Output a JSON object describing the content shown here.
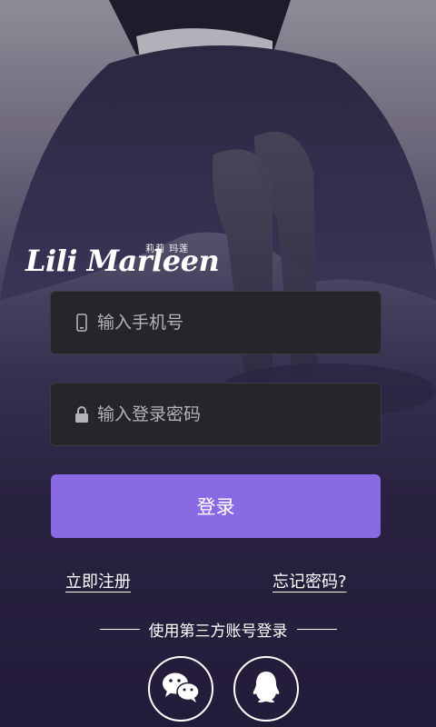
{
  "logo": {
    "name": "Lili Marleen",
    "subtitle": "莉莉 玛莲"
  },
  "form": {
    "phone_placeholder": "输入手机号",
    "password_placeholder": "输入登录密码",
    "login_label": "登录"
  },
  "links": {
    "register": "立即注册",
    "forgot": "忘记密码?"
  },
  "third_party": {
    "label": "使用第三方账号登录",
    "icons": [
      "wechat-icon",
      "qq-icon"
    ]
  },
  "colors": {
    "accent": "#8a6ae4",
    "field_bg": "#25252b"
  }
}
